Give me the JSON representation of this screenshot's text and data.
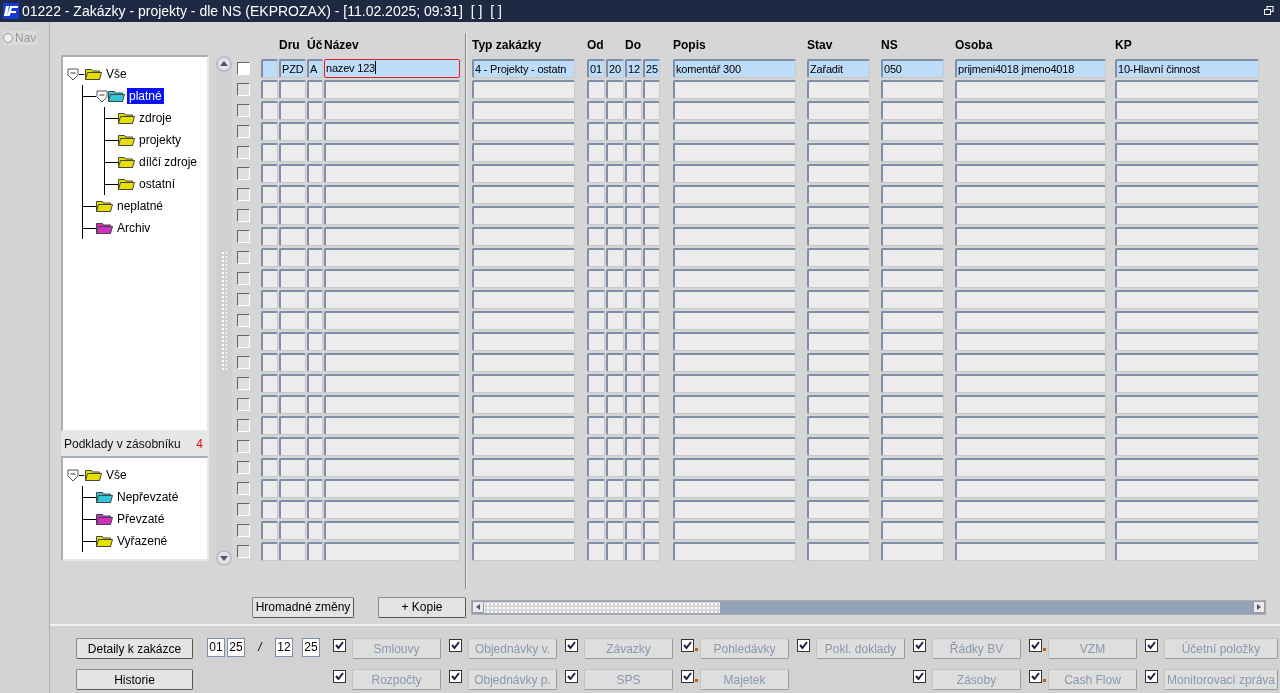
{
  "window": {
    "title": "01222 - Zakázky - projekty - dle NS (EKPROZAX) - [11.02.2025; 09:31]  [ ]  [ ]"
  },
  "nav": {
    "label": "Nav",
    "disabled": true
  },
  "tree": [
    {
      "label": "Vše",
      "color": "#e6e000",
      "expanded": true,
      "selected": false,
      "children": [
        {
          "label": "platné",
          "color": "#30c8d8",
          "expanded": true,
          "selected": true,
          "children": [
            {
              "label": "zdroje",
              "color": "#e6e000",
              "selected": false
            },
            {
              "label": "projekty",
              "color": "#e6e000",
              "selected": false
            },
            {
              "label": "dílčí zdroje",
              "color": "#e6e000",
              "selected": false
            },
            {
              "label": "ostatní",
              "color": "#e6e000",
              "selected": false
            }
          ]
        },
        {
          "label": "neplatné",
          "color": "#e6e000",
          "selected": false
        },
        {
          "label": "Archiv",
          "color": "#d030c0",
          "selected": false
        }
      ]
    }
  ],
  "stash": {
    "label": "Podklady v zásobníku",
    "count": "4"
  },
  "stash_tree": [
    {
      "label": "Vše",
      "color": "#e6e000",
      "expanded": true,
      "selected": false,
      "children": [
        {
          "label": "Nepřevzaté",
          "color": "#30c8d8",
          "selected": false
        },
        {
          "label": "Převzaté",
          "color": "#d030c0",
          "selected": false
        },
        {
          "label": "Vyřazené",
          "color": "#e6e000",
          "selected": false
        }
      ]
    }
  ],
  "table": {
    "columns": [
      {
        "label": "Dru"
      },
      {
        "label": "Úč"
      },
      {
        "label": "Název"
      },
      {
        "label": "Typ zakázky"
      },
      {
        "label": "Od"
      },
      {
        "label": "Do"
      },
      {
        "label": "Popis"
      },
      {
        "label": "Stav"
      },
      {
        "label": "NS"
      },
      {
        "label": "Osoba"
      },
      {
        "label": "KP"
      }
    ],
    "rows": [
      {
        "current": true,
        "checked": false,
        "cells": [
          {
            "text": "PZD",
            "focused": false
          },
          {
            "text": "A",
            "focused": false
          },
          {
            "text": "nazev 123",
            "focused": true
          },
          {
            "text": "4 - Projekty - ostatn",
            "focused": false
          },
          {
            "text": "01",
            "focused": false
          },
          {
            "text": "20",
            "focused": false
          },
          {
            "text": "12",
            "focused": false
          },
          {
            "text": "25",
            "focused": false
          },
          {
            "text": "komentář 300",
            "focused": false
          },
          {
            "text": "Zařadit",
            "focused": false
          },
          {
            "text": "050",
            "focused": false
          },
          {
            "text": "prijmeni4018 jmeno4018",
            "focused": false
          },
          {
            "text": "10-Hlavní činnost",
            "focused": false
          }
        ]
      },
      {
        "current": false,
        "checked": false
      },
      {
        "current": false,
        "checked": false
      },
      {
        "current": false,
        "checked": false
      },
      {
        "current": false,
        "checked": false
      },
      {
        "current": false,
        "checked": false
      },
      {
        "current": false,
        "checked": false
      },
      {
        "current": false,
        "checked": false
      },
      {
        "current": false,
        "checked": false
      },
      {
        "current": false,
        "checked": false
      },
      {
        "current": false,
        "checked": false
      },
      {
        "current": false,
        "checked": false
      },
      {
        "current": false,
        "checked": false
      },
      {
        "current": false,
        "checked": false
      },
      {
        "current": false,
        "checked": false
      },
      {
        "current": false,
        "checked": false
      },
      {
        "current": false,
        "checked": false
      },
      {
        "current": false,
        "checked": false
      },
      {
        "current": false,
        "checked": false
      },
      {
        "current": false,
        "checked": false
      },
      {
        "current": false,
        "checked": false
      },
      {
        "current": false,
        "checked": false
      },
      {
        "current": false,
        "checked": false
      },
      {
        "current": false,
        "checked": false
      }
    ]
  },
  "actions": [
    "Hromadné změny",
    "+ Kopie"
  ],
  "details": [
    "Detaily k zakázce",
    "Historie"
  ],
  "period": {
    "from_month": "01",
    "from_year": "25",
    "separator": "/",
    "to_month": "12",
    "to_year": "25"
  },
  "modules": [
    [
      {
        "kind": "toggle",
        "label": "Smlouvy",
        "checked": true,
        "disabled": true,
        "flag": false
      },
      {
        "kind": "toggle",
        "label": "Objednávky v.",
        "checked": true,
        "disabled": true,
        "flag": false
      },
      {
        "kind": "toggle",
        "label": "Závazky",
        "checked": true,
        "disabled": true,
        "flag": false
      },
      {
        "kind": "toggle",
        "label": "Pohledávky",
        "checked": true,
        "disabled": true,
        "flag": true
      },
      {
        "kind": "toggle",
        "label": "Pokl. doklady",
        "checked": true,
        "disabled": true,
        "flag": false
      },
      {
        "kind": "toggle",
        "label": "Řádky BV",
        "checked": true,
        "disabled": true,
        "flag": false
      },
      {
        "kind": "toggle",
        "label": "VZM",
        "checked": true,
        "disabled": true,
        "flag": true
      },
      {
        "kind": "toggle",
        "label": "Účetní položky",
        "checked": true,
        "disabled": true,
        "flag": false
      }
    ],
    [
      {
        "kind": "toggle",
        "label": "Rozpočty",
        "checked": true,
        "disabled": true,
        "flag": false
      },
      {
        "kind": "toggle",
        "label": "Objednávky p.",
        "checked": true,
        "disabled": true,
        "flag": false
      },
      {
        "kind": "toggle",
        "label": "SPS",
        "checked": true,
        "disabled": true,
        "flag": false
      },
      {
        "kind": "toggle",
        "label": "Majetek",
        "checked": true,
        "disabled": true,
        "flag": true
      },
      {
        "kind": "empty"
      },
      {
        "kind": "toggle",
        "label": "Zásoby",
        "checked": true,
        "disabled": true,
        "flag": false
      },
      {
        "kind": "toggle",
        "label": "Cash Flow",
        "checked": true,
        "disabled": true,
        "flag": true
      },
      {
        "kind": "toggle",
        "label": "Monitorovací zpráva",
        "checked": true,
        "disabled": true,
        "flag": false
      }
    ]
  ]
}
